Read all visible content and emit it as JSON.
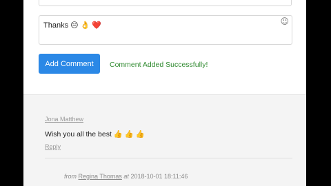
{
  "comment_form": {
    "input_value": "Thanks 😑 👌 ❤️",
    "emoji_picker_icon": "☺",
    "submit_label": "Add Comment",
    "success_message": "Comment Added Successfully!"
  },
  "comments": [
    {
      "author": "Jona Matthew",
      "text": "Wish you all the best 👍 👍 👍",
      "reply_label": "Reply"
    }
  ],
  "reply_meta": {
    "from_label": "from",
    "author": "Regina Thomas",
    "at_label": "at",
    "timestamp": "2018-10-01 18:11:46"
  },
  "colors": {
    "button_bg": "#2b88e6",
    "success_text": "#2f8a2f",
    "muted_text": "#9a9a9a"
  },
  "icons": {
    "emoji_picker": "smiley-face-icon"
  }
}
